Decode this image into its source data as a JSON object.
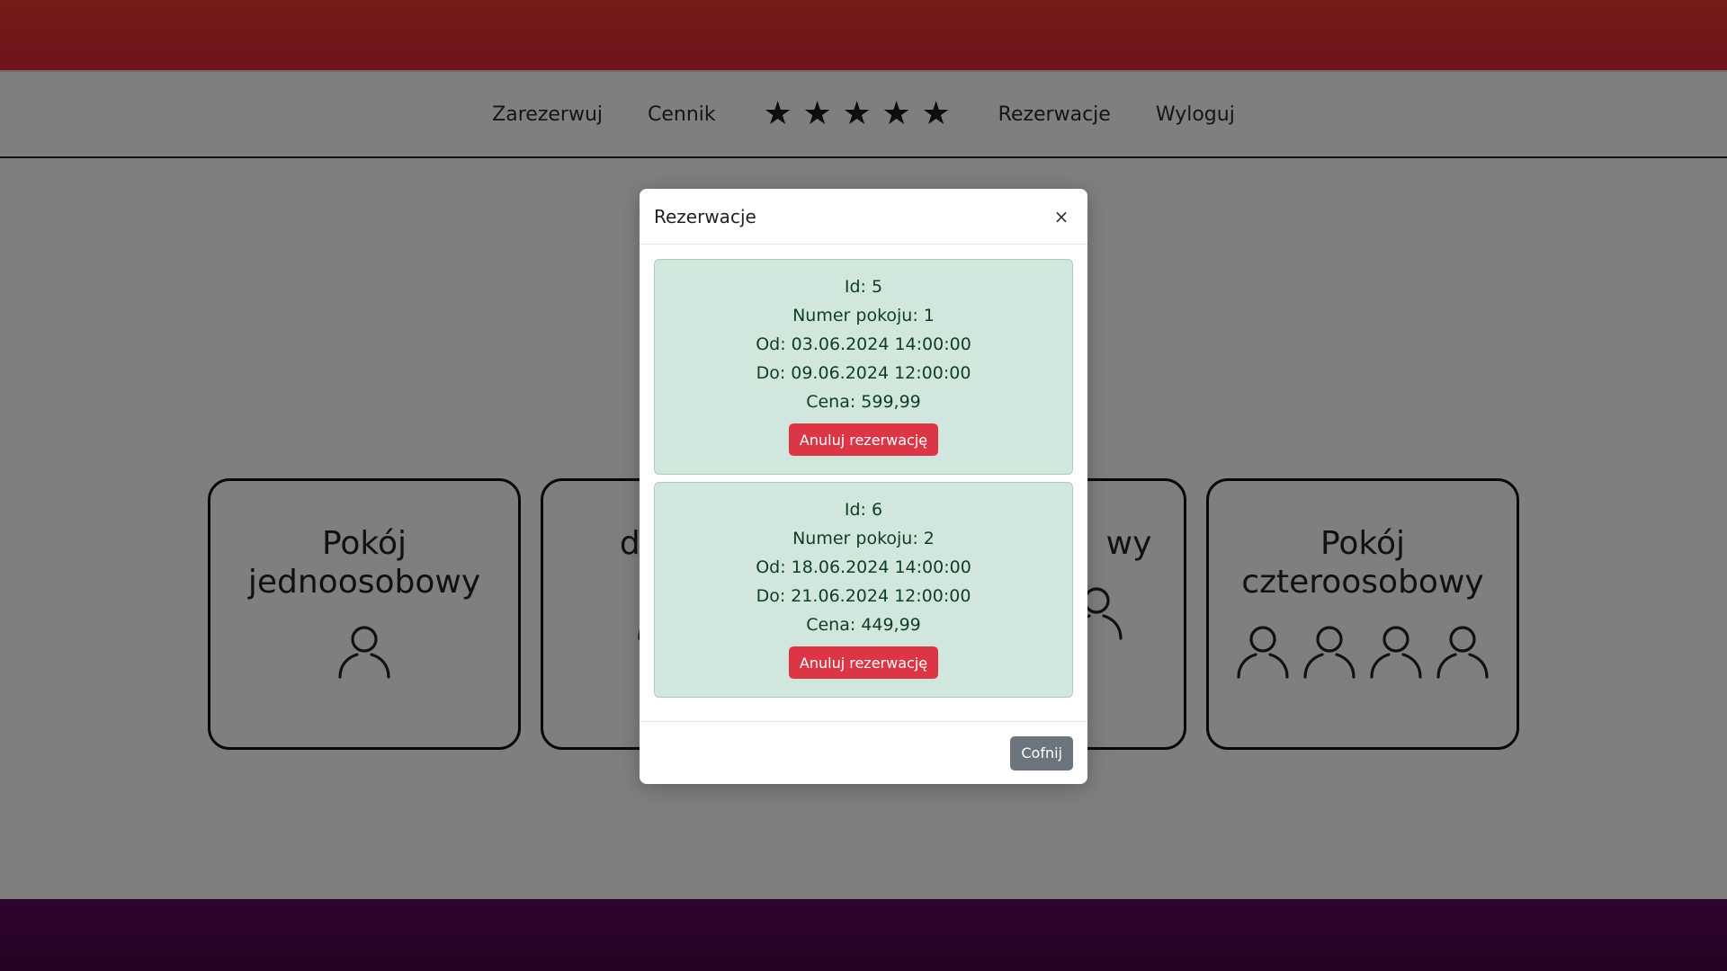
{
  "nav": {
    "links": [
      {
        "label": "Zarezerwuj"
      },
      {
        "label": "Cennik"
      },
      {
        "label": "Rezerwacje"
      },
      {
        "label": "Wyloguj"
      }
    ],
    "rating": 5,
    "star_glyph": "★"
  },
  "rooms": [
    {
      "title_line1": "Pokój",
      "title_line2": "jednoosobowy",
      "people": 1
    },
    {
      "title_line1": "",
      "title_line2": "dw",
      "people": 2
    },
    {
      "title_line1": "",
      "title_line2": "wy",
      "people": 3
    },
    {
      "title_line1": "Pokój",
      "title_line2": "czteroosobowy",
      "people": 4
    }
  ],
  "modal": {
    "title": "Rezerwacje",
    "close_icon": "×",
    "reservations": [
      {
        "id": "Id: 5",
        "room": "Numer pokoju: 1",
        "from": "Od: 03.06.2024 14:00:00",
        "to": "Do: 09.06.2024 12:00:00",
        "price": "Cena: 599,99",
        "cancel_label": "Anuluj rezerwację"
      },
      {
        "id": "Id: 6",
        "room": "Numer pokoju: 2",
        "from": "Od: 18.06.2024 14:00:00",
        "to": "Do: 21.06.2024 12:00:00",
        "price": "Cena: 449,99",
        "cancel_label": "Anuluj rezerwację"
      }
    ],
    "back_label": "Cofnij"
  },
  "colors": {
    "top_banner": "#e02f33",
    "bottom_band": "#520650",
    "reservation_bg": "#d1e7dd",
    "cancel_button": "#dc3545",
    "back_button": "#6c757d"
  }
}
